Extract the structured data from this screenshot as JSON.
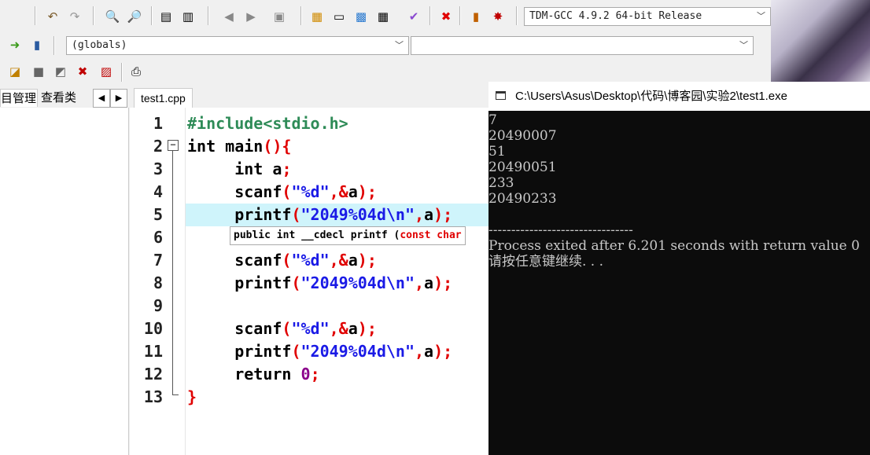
{
  "toolbar": {
    "compiler": "TDM-GCC 4.9.2 64-bit Release",
    "scope": "(globals)",
    "scope2": ""
  },
  "panel": {
    "tab_project": "目管理",
    "tab_class": "查看类"
  },
  "editor": {
    "tab_label": "test1.cpp",
    "line_numbers": [
      "1",
      "2",
      "3",
      "4",
      "5",
      "6",
      "7",
      "8",
      "9",
      "10",
      "11",
      "12",
      "13"
    ],
    "tooltip": {
      "prefix": "public int __cdecl printf (",
      "param": "const char"
    }
  },
  "console": {
    "title": "C:\\Users\\Asus\\Desktop\\代码\\博客园\\实验2\\test1.exe",
    "lines": [
      "7",
      "20490007",
      "51",
      "20490051",
      "233",
      "20490233",
      "",
      "--------------------------------",
      "Process exited after 6.201 seconds with return value 0",
      "请按任意键继续. . ."
    ]
  },
  "colors": {
    "highlight_line": "#cff4fb",
    "string": "#1a1ae6",
    "symbol": "#e00000",
    "preprocessor": "#2e8b57",
    "number": "#8b008b"
  }
}
